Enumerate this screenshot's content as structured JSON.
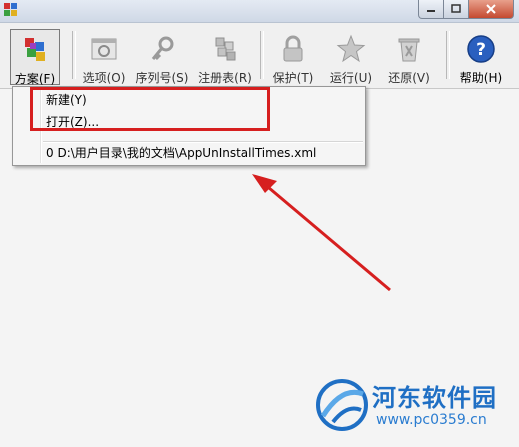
{
  "titlebar": {
    "controls": [
      "minimize-icon",
      "maximize-icon",
      "close-icon"
    ]
  },
  "toolbar": {
    "buttons": [
      {
        "label": "方案(F)",
        "icon": "plan-cube-icon",
        "state": "pressed"
      },
      {
        "label": "选项(O)",
        "icon": "options-window-icon",
        "state": "disabled"
      },
      {
        "label": "序列号(S)",
        "icon": "key-icon",
        "state": "disabled"
      },
      {
        "label": "注册表(R)",
        "icon": "registry-cubes-icon",
        "state": "disabled"
      },
      {
        "label": "保护(T)",
        "icon": "lock-icon",
        "state": "disabled"
      },
      {
        "label": "运行(U)",
        "icon": "star-icon",
        "state": "disabled"
      },
      {
        "label": "还原(V)",
        "icon": "recycle-bin-icon",
        "state": "disabled"
      },
      {
        "label": "帮助(H)",
        "icon": "help-icon",
        "state": "normal"
      }
    ]
  },
  "menu": {
    "items": [
      {
        "label": "新建(Y)"
      },
      {
        "label": "打开(Z)..."
      },
      {
        "label": "0 D:\\用户目录\\我的文档\\AppUnInstallTimes.xml"
      }
    ]
  },
  "watermark": {
    "title": "河东软件园",
    "url": "www.pc0359.cn"
  },
  "colors": {
    "annotation": "#d61f1f",
    "watermark": "#1f6fc4"
  }
}
